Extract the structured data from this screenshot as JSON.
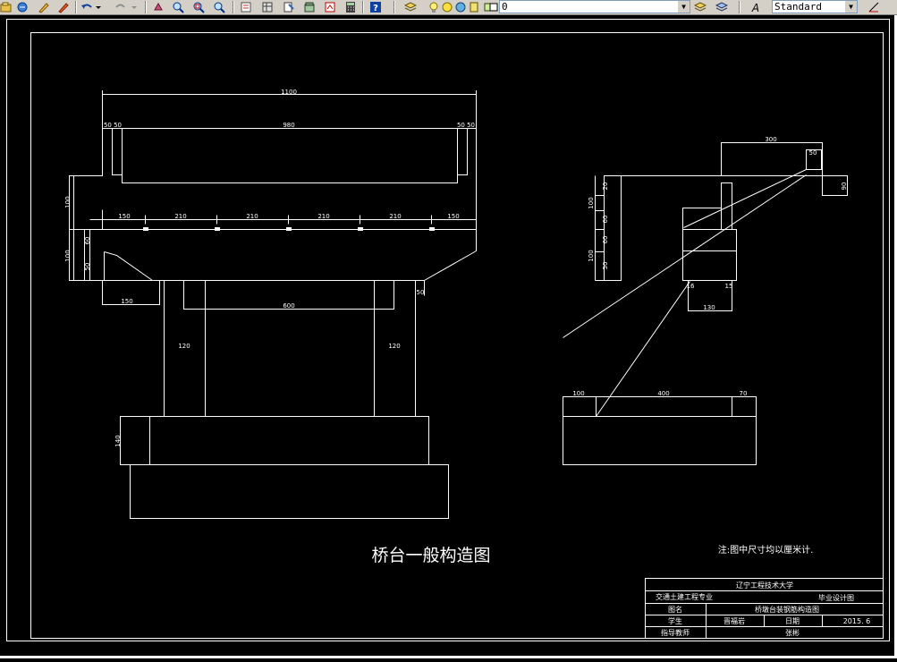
{
  "toolbar": {
    "layer_value": "0",
    "text_style_value": "Standard",
    "icons": [
      "open-icon",
      "pen-icon",
      "brush-icon",
      "undo-icon",
      "redo-icon",
      "pan-icon",
      "zoom-realtime-icon",
      "zoom-window-icon",
      "zoom-previous-icon",
      "properties-icon",
      "design-center-icon",
      "tool-palette-icon",
      "sheet-set-icon",
      "markup-icon",
      "calculator-icon",
      "help-icon",
      "layer-manager-icon",
      "layer-state-icon",
      "layer-previous-icon",
      "text-style-icon",
      "dim-style-icon"
    ]
  },
  "drawing": {
    "main_title": "桥台一般构造图",
    "note": "注:图中尺寸均以厘米计.",
    "front_view": {
      "dims": {
        "total_width": "1100",
        "inner_width": "980",
        "left_small": "50 50",
        "right_small": "50 50",
        "bearing_spacing": [
          "150",
          "210",
          "210",
          "210",
          "210",
          "150"
        ],
        "left_vertical_1": "100",
        "left_vertical_2": "60",
        "left_vertical_3": "100",
        "left_vertical_4": "50",
        "bottom_left": "150",
        "bottom_right": "50",
        "column_spacing": "600",
        "column_left": "120",
        "column_right": "120",
        "footing_height": "140"
      }
    },
    "side_view": {
      "dims": {
        "top_width": "300",
        "top_right_small": "50",
        "right_small": "90",
        "v1": "20",
        "v2": "100",
        "v3": "60",
        "v4": "60",
        "v5": "100",
        "v6": "50",
        "small_left": "16",
        "small_right": "15",
        "mid_width": "130",
        "footing_left": "100",
        "footing_mid": "400",
        "footing_right": "70"
      }
    },
    "title_block": {
      "university": "辽宁工程技术大学",
      "major": "交通土建工程专业",
      "design_type": "毕业设计图",
      "label_drawing_name": "图名",
      "drawing_name": "桥墩台装钢筋构造图",
      "label_student": "学生",
      "student_name": "晋福岩",
      "label_date": "日期",
      "date_value": "2015. 6",
      "label_advisor": "指导教师",
      "advisor_name": "张彬"
    }
  }
}
